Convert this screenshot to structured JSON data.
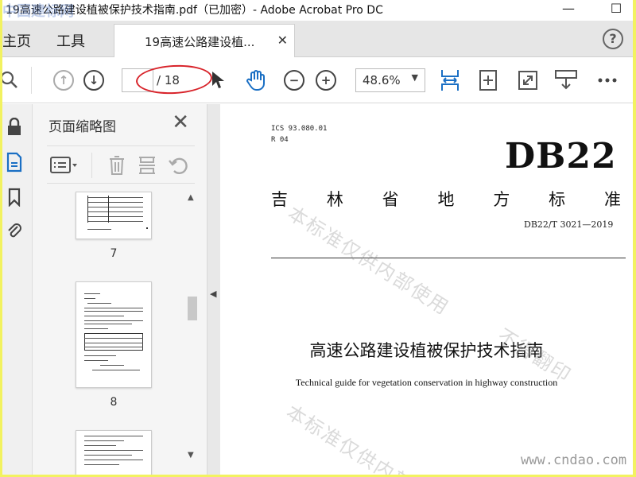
{
  "window": {
    "title": "19高速公路建设植被保护技术指南.pdf（已加密）- Adobe Acrobat Pro DC",
    "minimize": "—",
    "restore": "☐",
    "watermark_overlay": "中国建标网"
  },
  "menu": {
    "home": "主页",
    "tools": "工具",
    "tab_label": "19高速公路建设植...",
    "tab_close": "✕",
    "help": "?"
  },
  "toolbar": {
    "page_current": "",
    "page_total": "/ 18",
    "zoom": "48.6%"
  },
  "thumbnails": {
    "title": "页面缩略图",
    "close": "✕",
    "pages": [
      "7",
      "8"
    ]
  },
  "document": {
    "ics": "ICS 93.080.01",
    "r": "R 04",
    "db": "DB22",
    "province_chars": [
      "吉",
      "林",
      "省",
      "地",
      "方",
      "标",
      "准"
    ],
    "code": "DB22/T 3021—2019",
    "title": "高速公路建设植被保护技术指南",
    "subtitle": "Technical guide for vegetation conservation in highway construction",
    "watermark_1": "本标准仅供内部使用",
    "watermark_2": "不得翻印",
    "watermark_3": "本标准仅供内部",
    "site": "www.cndao.com"
  },
  "colors": {
    "frame_border": "#f2f260",
    "accent_blue": "#1a6fc4",
    "annotation_red": "#d8232a"
  }
}
